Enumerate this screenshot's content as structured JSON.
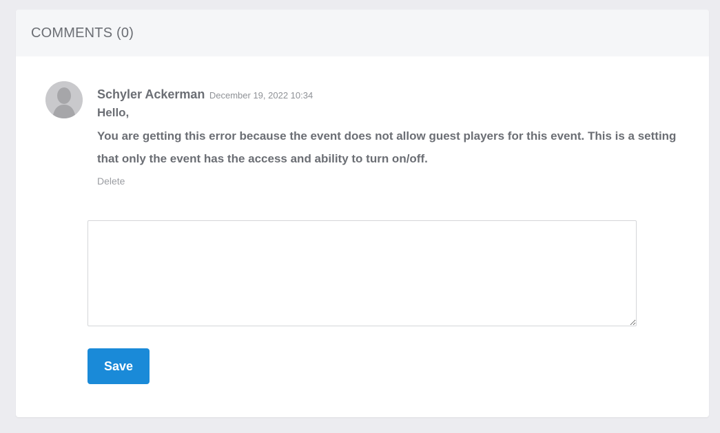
{
  "comments_panel": {
    "title": "COMMENTS (0)"
  },
  "comment": {
    "author": "Schyler Ackerman",
    "timestamp": "December 19, 2022 10:34",
    "greeting": "Hello,",
    "message": "You are getting this error because the event does not allow guest players for this event. This is a setting that only the event has the access and ability to turn on/off.",
    "delete_label": "Delete",
    "avatar_icon": "default-user-silhouette-icon"
  },
  "reply_form": {
    "textarea_value": "",
    "save_label": "Save"
  },
  "colors": {
    "page_background": "#ececf0",
    "header_background": "#f5f6f8",
    "primary_button": "#1a8ad8",
    "text_primary": "#6b6e74",
    "text_muted": "#8e9196"
  }
}
